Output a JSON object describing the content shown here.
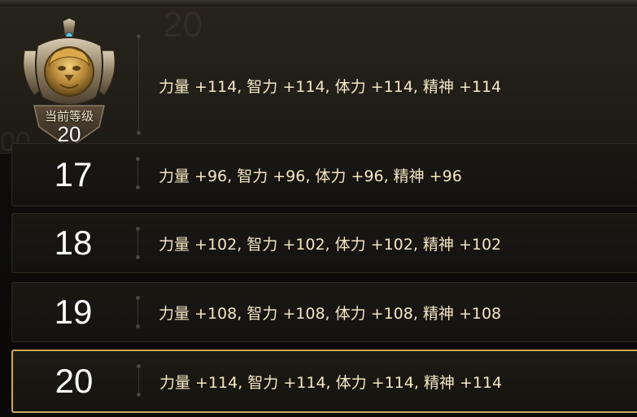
{
  "current": {
    "badge_label": "当前等级",
    "level": "20",
    "bonus": "力量 +114, 智力 +114, 体力 +114, 精神 +114"
  },
  "rows": [
    {
      "level": "17",
      "bonus": "力量 +96, 智力 +96, 体力 +96, 精神 +96",
      "selected": false
    },
    {
      "level": "18",
      "bonus": "力量 +102, 智力 +102, 体力 +102, 精神 +102",
      "selected": false
    },
    {
      "level": "19",
      "bonus": "力量 +108, 智力 +108, 体力 +108, 精神 +108",
      "selected": false
    },
    {
      "level": "20",
      "bonus": "力量 +114, 智力 +114, 体力 +114, 精神 +114",
      "selected": true
    }
  ],
  "icons": {
    "badge": "lion-shield-badge-icon"
  },
  "colors": {
    "text_gold": "#f3e6c4",
    "selected_border": "#c9a95e",
    "level_number": "#ffffff"
  }
}
